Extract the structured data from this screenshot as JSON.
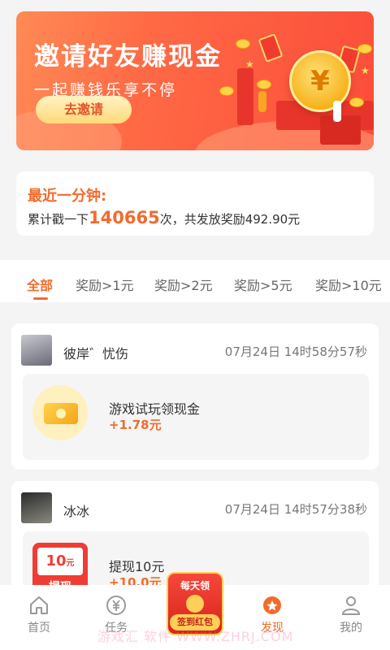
{
  "banner": {
    "title": "邀请好友赚现金",
    "subtitle": "一起赚钱乐享不停",
    "invite_button": "去邀请",
    "coin_symbol": "¥"
  },
  "stats": {
    "title": "最近一分钟:",
    "prefix": "累计戳一下",
    "count": "140665",
    "suffix": "次，共发放奖励492.90元"
  },
  "tabs": [
    {
      "label": "全部",
      "active": true
    },
    {
      "label": "奖励>1元"
    },
    {
      "label": "奖励>2元"
    },
    {
      "label": "奖励>5元"
    },
    {
      "label": "奖励>10元"
    }
  ],
  "feed": [
    {
      "user": "彼岸゛忧伤",
      "time": "07月24日 14时58分57秒",
      "reward_title": "游戏试玩领现金",
      "reward_amount": "+1.78元",
      "icon": "money-icon"
    },
    {
      "user": "冰冰",
      "time": "07月24日 14时57分38秒",
      "reward_title": "提现10元",
      "reward_amount": "+10.0元",
      "icon_value": "10",
      "icon_unit": "元",
      "icon_label": "提现"
    }
  ],
  "nav": {
    "items": [
      {
        "label": "首页",
        "icon": "home-icon"
      },
      {
        "label": "任务",
        "icon": "yuan-icon"
      },
      {
        "label": "发现",
        "icon": "discover-icon",
        "active": true
      },
      {
        "label": "我的",
        "icon": "user-icon"
      }
    ],
    "center": {
      "top": "每天领",
      "bottom": "签到红包"
    }
  },
  "watermark": "游戏汇 软件  WWW.ZHRJ.COM",
  "colors": {
    "accent": "#f26b2e",
    "banner": "#fb4d3a"
  }
}
